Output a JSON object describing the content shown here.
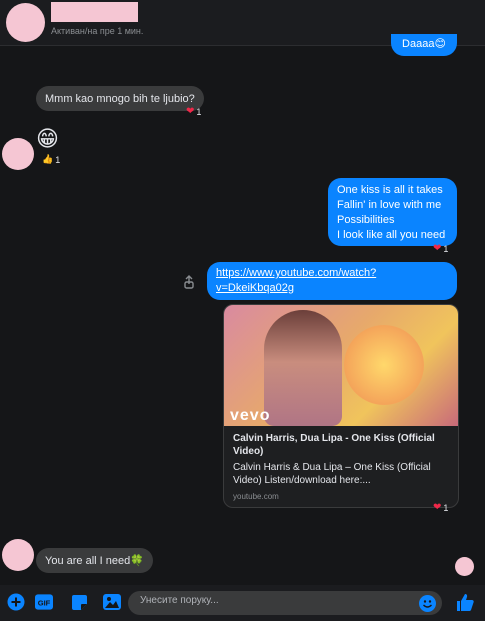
{
  "header": {
    "status": "Активан/на пре 1 мин."
  },
  "messages": {
    "top_out_partial": "Daaaa😊",
    "m1_text": "Mmm kao mnogo bih te ljubio?",
    "m1_reaction_count": "1",
    "m2_emoji": "😁",
    "m2_reaction_count": "1",
    "m3_lines": [
      "One kiss is all it takes",
      "Fallin' in love with me",
      "Possibilities",
      "I look like all you need"
    ],
    "m3_reaction_count": "1",
    "m4_link_line1": "https://www.youtube.com/watch?",
    "m4_link_line2": "v=DkeiKbqa02g",
    "m4_reaction_count": "1",
    "m5_text": "You are all I need🍀"
  },
  "link_card": {
    "brand": "vevo",
    "title": "Calvin Harris, Dua Lipa - One Kiss (Official Video)",
    "description": "Calvin Harris & Dua Lipa – One Kiss (Official Video) Listen/download here:...",
    "domain": "youtube.com"
  },
  "composer": {
    "placeholder": "Унесите поруку..."
  },
  "colors": {
    "background": "#151618",
    "outgoing_bubble": "#0a84ff",
    "incoming_bubble": "#3a3b3c",
    "heart": "#f02849",
    "avatar_placeholder": "#f5c6d3"
  },
  "icons": [
    "plus-icon",
    "gif-icon",
    "sticker-icon",
    "image-icon",
    "emoji-icon",
    "thumbs-up-icon",
    "share-icon",
    "heart-icon"
  ]
}
